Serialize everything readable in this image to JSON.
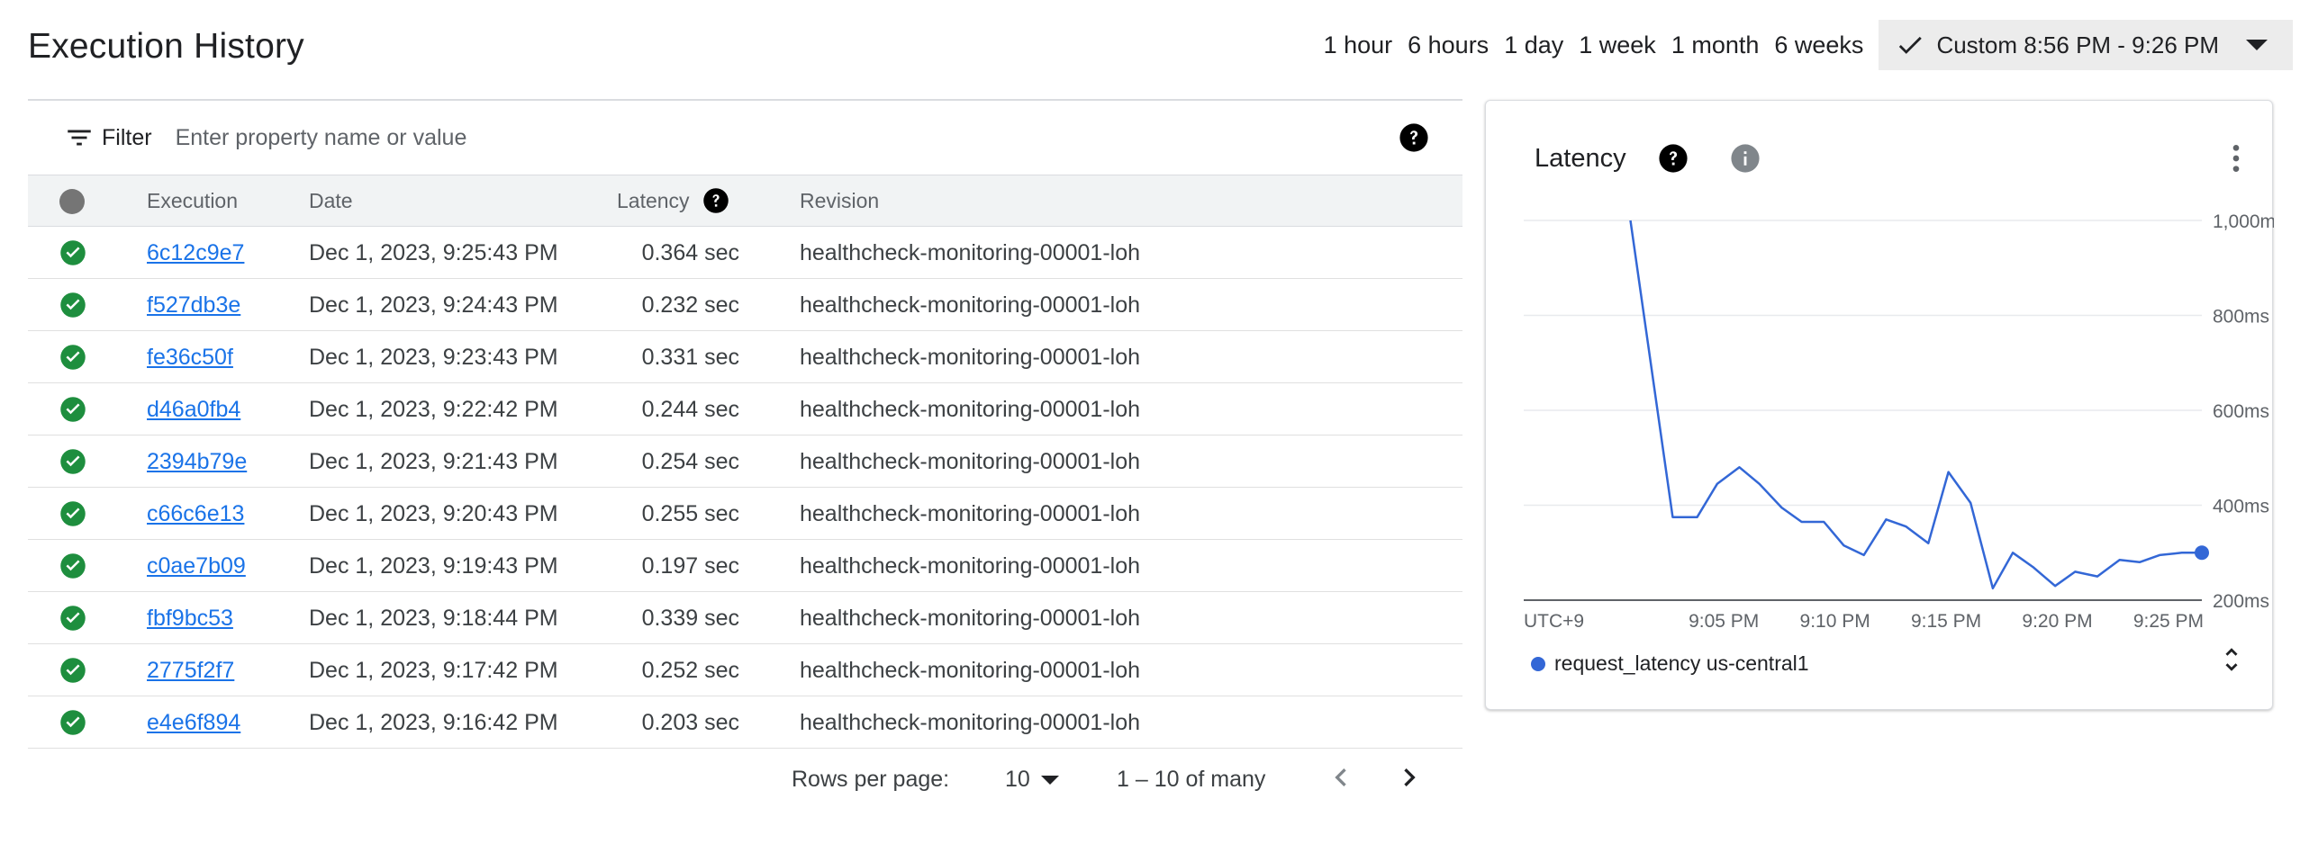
{
  "page": {
    "title": "Execution History"
  },
  "time_range": {
    "options": [
      "1 hour",
      "6 hours",
      "1 day",
      "1 week",
      "1 month",
      "6 weeks"
    ],
    "custom_label": "Custom 8:56 PM - 9:26 PM"
  },
  "filter": {
    "label": "Filter",
    "placeholder": "Enter property name or value"
  },
  "table": {
    "headers": {
      "execution": "Execution",
      "date": "Date",
      "latency": "Latency",
      "revision": "Revision"
    },
    "rows": [
      {
        "execution": "6c12c9e7",
        "date": "Dec 1, 2023, 9:25:43 PM",
        "latency": "0.364 sec",
        "revision": "healthcheck-monitoring-00001-loh"
      },
      {
        "execution": "f527db3e",
        "date": "Dec 1, 2023, 9:24:43 PM",
        "latency": "0.232 sec",
        "revision": "healthcheck-monitoring-00001-loh"
      },
      {
        "execution": "fe36c50f",
        "date": "Dec 1, 2023, 9:23:43 PM",
        "latency": "0.331 sec",
        "revision": "healthcheck-monitoring-00001-loh"
      },
      {
        "execution": "d46a0fb4",
        "date": "Dec 1, 2023, 9:22:42 PM",
        "latency": "0.244 sec",
        "revision": "healthcheck-monitoring-00001-loh"
      },
      {
        "execution": "2394b79e",
        "date": "Dec 1, 2023, 9:21:43 PM",
        "latency": "0.254 sec",
        "revision": "healthcheck-monitoring-00001-loh"
      },
      {
        "execution": "c66c6e13",
        "date": "Dec 1, 2023, 9:20:43 PM",
        "latency": "0.255 sec",
        "revision": "healthcheck-monitoring-00001-loh"
      },
      {
        "execution": "c0ae7b09",
        "date": "Dec 1, 2023, 9:19:43 PM",
        "latency": "0.197 sec",
        "revision": "healthcheck-monitoring-00001-loh"
      },
      {
        "execution": "fbf9bc53",
        "date": "Dec 1, 2023, 9:18:44 PM",
        "latency": "0.339 sec",
        "revision": "healthcheck-monitoring-00001-loh"
      },
      {
        "execution": "2775f2f7",
        "date": "Dec 1, 2023, 9:17:42 PM",
        "latency": "0.252 sec",
        "revision": "healthcheck-monitoring-00001-loh"
      },
      {
        "execution": "e4e6f894",
        "date": "Dec 1, 2023, 9:16:42 PM",
        "latency": "0.203 sec",
        "revision": "healthcheck-monitoring-00001-loh"
      }
    ]
  },
  "pagination": {
    "rows_per_page_label": "Rows per page:",
    "rows_per_page_value": "10",
    "range_text": "1 – 10 of many"
  },
  "colors": {
    "success": "#1e8e3e",
    "link": "#1a73e8",
    "series": "#3367d6"
  },
  "chart": {
    "title": "Latency",
    "timezone_label": "UTC+9"
  },
  "chart_data": {
    "type": "line",
    "title": "Latency",
    "xlabel": "",
    "ylabel": "",
    "x_ticks": [
      "9:05 PM",
      "9:10 PM",
      "9:15 PM",
      "9:20 PM",
      "9:25 PM"
    ],
    "y_ticks": [
      "200ms",
      "400ms",
      "600ms",
      "800ms",
      "1,000ms"
    ],
    "x_domain_minutes": [
      0,
      30.5
    ],
    "ylim": [
      200,
      1000
    ],
    "grid": true,
    "legend_position": "bottom-left",
    "series": [
      {
        "name": "request_latency us-central1",
        "x": [
          4.8,
          6.7,
          7.8,
          8.7,
          9.7,
          10.6,
          11.6,
          12.5,
          13.5,
          14.4,
          15.3,
          16.3,
          17.2,
          18.2,
          19.1,
          20.1,
          21.1,
          22.0,
          22.9,
          23.9,
          24.8,
          25.8,
          26.8,
          27.7,
          28.6,
          29.6,
          30.5
        ],
        "values": [
          1000,
          375,
          375,
          445,
          480,
          445,
          395,
          365,
          365,
          315,
          295,
          370,
          355,
          320,
          470,
          405,
          225,
          300,
          270,
          230,
          260,
          250,
          285,
          280,
          295,
          300,
          300
        ]
      }
    ]
  }
}
